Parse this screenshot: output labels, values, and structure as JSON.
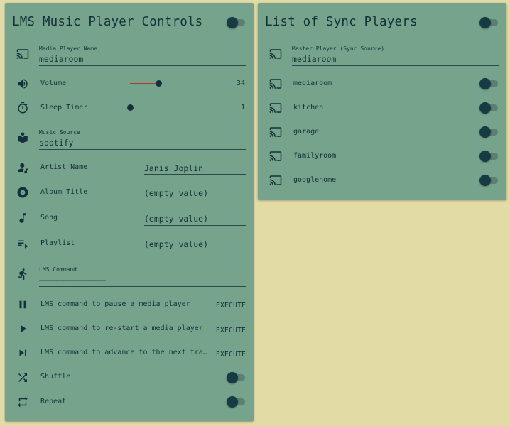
{
  "left_card": {
    "title": "LMS Music Player Controls",
    "media_player": {
      "caption": "Media Player Name",
      "value": "mediaroom"
    },
    "volume": {
      "label": "Volume",
      "value": "34",
      "level": 0.34
    },
    "sleep_timer": {
      "label": "Sleep Timer",
      "value": "1",
      "level": 0.0
    },
    "music_source": {
      "caption": "Music Source",
      "value": "spotify"
    },
    "artist": {
      "label": "Artist Name",
      "value": "Janis Joplin"
    },
    "album": {
      "label": "Album Title",
      "value": "(empty value)"
    },
    "song": {
      "label": "Song",
      "value": "(empty value)"
    },
    "playlist": {
      "label": "Playlist",
      "value": "(empty value)"
    },
    "lms_command": {
      "caption": "LMS Command",
      "value": "___________________"
    },
    "commands": [
      {
        "label": "LMS command to pause a media player",
        "button": "EXECUTE",
        "icon": "pause-icon"
      },
      {
        "label": "LMS command to re-start a media player",
        "button": "EXECUTE",
        "icon": "play-icon"
      },
      {
        "label": "LMS command to advance to the next tra…",
        "button": "EXECUTE",
        "icon": "skip-next-icon"
      }
    ],
    "shuffle": {
      "label": "Shuffle"
    },
    "repeat": {
      "label": "Repeat"
    }
  },
  "right_card": {
    "title": "List of Sync Players",
    "master": {
      "caption": "Master Player (Sync Source)",
      "value": "mediaroom"
    },
    "players": [
      "mediaroom",
      "kitchen",
      "garage",
      "familyroom",
      "googlehome"
    ]
  },
  "colors": {
    "background": "#e3dba6",
    "card": "#76a38b",
    "text": "#14303a",
    "slider_active": "#b0392d"
  }
}
